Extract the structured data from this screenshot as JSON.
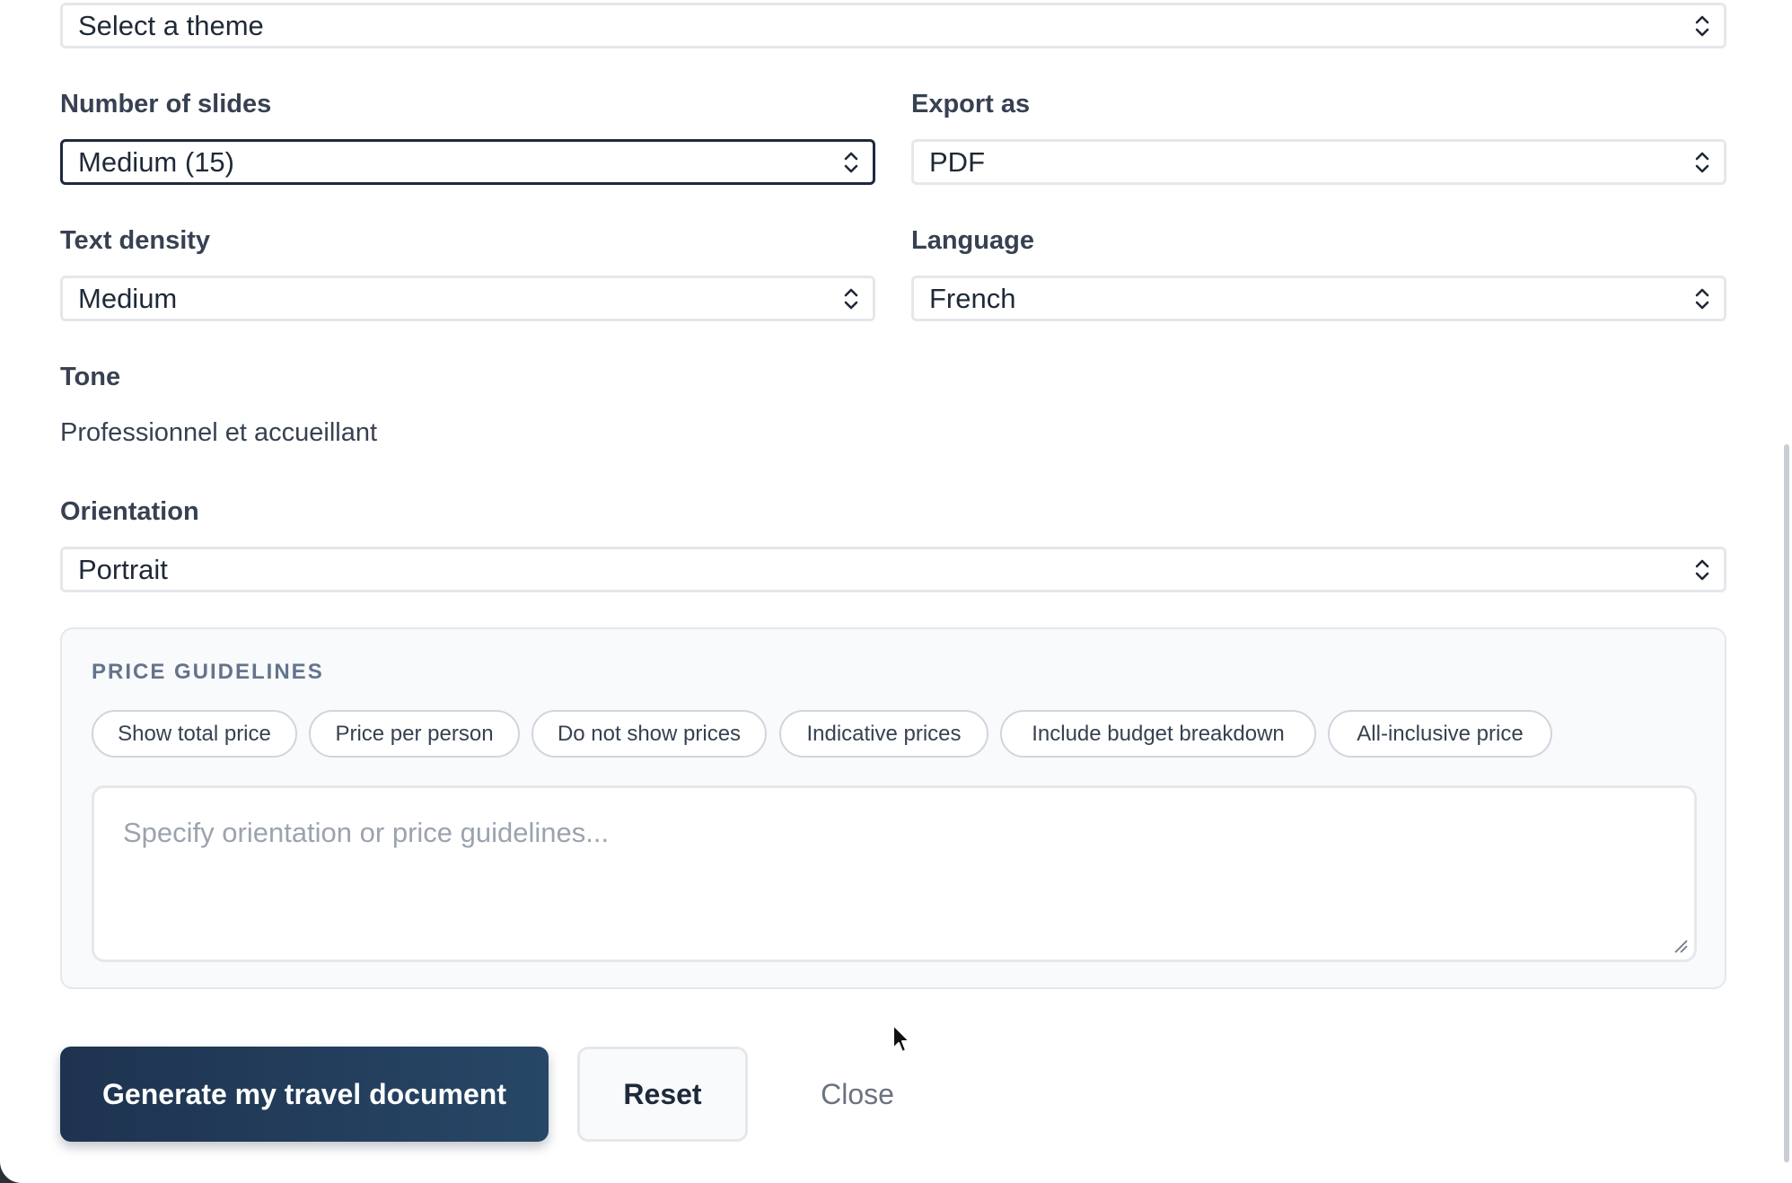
{
  "theme_select": {
    "value": "Select a theme",
    "icon": "updown-chevron-icon"
  },
  "slides": {
    "label": "Number of slides",
    "value": "Medium (15)"
  },
  "export": {
    "label": "Export as",
    "value": "PDF"
  },
  "density": {
    "label": "Text density",
    "value": "Medium"
  },
  "language": {
    "label": "Language",
    "value": "French"
  },
  "tone": {
    "label": "Tone",
    "value": "Professionnel et accueillant"
  },
  "orientation": {
    "label": "Orientation",
    "value": "Portrait"
  },
  "price_guidelines": {
    "title": "PRICE GUIDELINES",
    "chips": [
      "Show total price",
      "Price per person",
      "Do not show prices",
      "Indicative prices",
      "Include budget breakdown",
      "All-inclusive price"
    ],
    "placeholder": "Specify orientation or price guidelines..."
  },
  "actions": {
    "generate": "Generate my travel document",
    "reset": "Reset",
    "close": "Close"
  },
  "colors": {
    "primary": "#1e3350",
    "focus_border": "#1e293b",
    "panel_bg": "#f8fafc"
  }
}
